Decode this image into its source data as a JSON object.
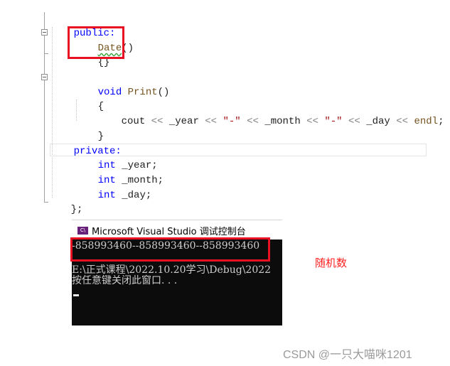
{
  "editor": {
    "lines": {
      "public_label": "public:",
      "ctor_name": "Date",
      "ctor_parens": "()",
      "ctor_body": "{}",
      "void_kw": "void",
      "print_name": "Print",
      "print_parens": "()",
      "open_brace": "{",
      "cout_stmt": {
        "cout": "cout",
        "op": "<<",
        "year": "_year",
        "dash": "\"-\"",
        "month": "_month",
        "day": "_day",
        "endl": "endl",
        "semi": ";"
      },
      "close_brace": "}",
      "private_label": "private:",
      "int_kw": "int",
      "member_year": "_year;",
      "member_month": "_month;",
      "member_day": "_day;",
      "class_end": "};"
    }
  },
  "console": {
    "icon_text": "C\\",
    "title": "Microsoft Visual Studio 调试控制台",
    "output_line": "-858993460--858993460--858993460",
    "path_line": "E:\\正式课程\\2022.10.20学习\\Debug\\2022",
    "prompt_line": "按任意键关闭此窗口. . ."
  },
  "annotation": {
    "text": "随机数",
    "color": "#ff2020"
  },
  "highlight_color": "#e81123",
  "watermark": "CSDN @一只大喵咪1201"
}
